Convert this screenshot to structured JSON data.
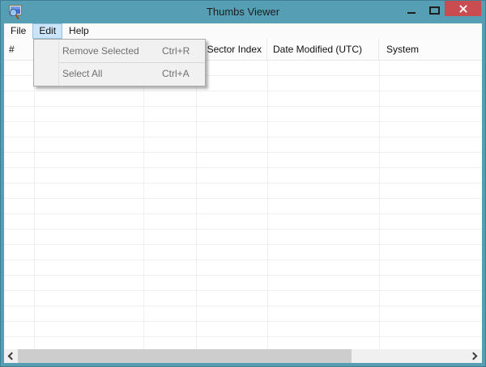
{
  "window": {
    "title": "Thumbs Viewer"
  },
  "menubar": {
    "items": [
      "File",
      "Edit",
      "Help"
    ],
    "active_item": "Edit"
  },
  "edit_menu": {
    "items": [
      {
        "label": "Remove Selected",
        "shortcut": "Ctrl+R",
        "enabled": false
      },
      {
        "label": "Select All",
        "shortcut": "Ctrl+A",
        "enabled": false
      }
    ]
  },
  "table": {
    "columns": [
      {
        "label": "#"
      },
      {
        "label": ""
      },
      {
        "label": ""
      },
      {
        "label": "Sector Index"
      },
      {
        "label": "Date Modified (UTC)"
      },
      {
        "label": "System"
      }
    ],
    "rows": []
  },
  "colors": {
    "titlebar_teal": "#559eb4",
    "close_button_red": "#c94c51",
    "menu_highlight_blue": "#cbe4f7",
    "disabled_text_gray": "#6f6f6f"
  }
}
